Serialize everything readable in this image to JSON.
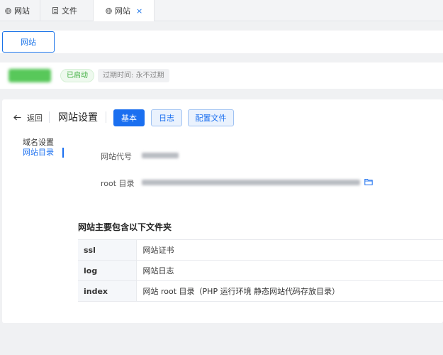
{
  "tabs": [
    {
      "label": "网站",
      "icon": "globe-icon"
    },
    {
      "label": "文件",
      "icon": "file-icon"
    },
    {
      "label": "网站",
      "icon": "globe-icon",
      "closable": true,
      "close_glyph": "×"
    }
  ],
  "site_chip": {
    "label": "网站"
  },
  "status": {
    "running": "已启动",
    "expiry": "过期时间: 永不过期"
  },
  "header": {
    "back_label": "返回",
    "title": "网站设置",
    "buttons": [
      {
        "label": "基本",
        "active": true
      },
      {
        "label": "日志",
        "active": false
      },
      {
        "label": "配置文件",
        "active": false
      }
    ]
  },
  "side_nav": [
    {
      "label": "域名设置",
      "active": false
    },
    {
      "label": "网站目录",
      "active": true
    }
  ],
  "fields": {
    "code_label": "网站代号",
    "root_label": "root 目录"
  },
  "folders": {
    "title": "网站主要包含以下文件夹",
    "rows": [
      {
        "name": "ssl",
        "desc": "网站证书"
      },
      {
        "name": "log",
        "desc": "网站日志"
      },
      {
        "name": "index",
        "desc": "网站 root 目录（PHP 运行环境 静态网站代码存放目录）"
      }
    ]
  },
  "colors": {
    "accent": "#1a6ff0",
    "success": "#3fae3f"
  }
}
